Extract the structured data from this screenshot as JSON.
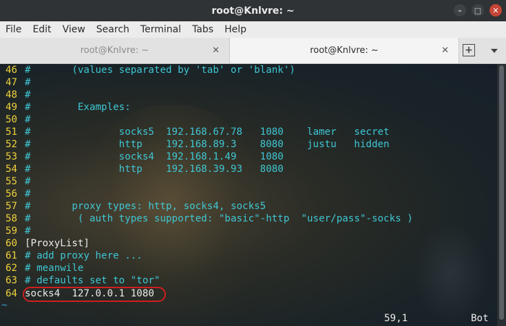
{
  "window": {
    "title": "root@Knlvre: ~",
    "btn_min": "–",
    "btn_max": "□",
    "btn_close": "✕"
  },
  "menu": [
    "File",
    "Edit",
    "View",
    "Search",
    "Terminal",
    "Tabs",
    "Help"
  ],
  "tabs": [
    {
      "label": "root@Knlvre: ~",
      "active": false
    },
    {
      "label": "root@Knlvre: ~",
      "active": true
    }
  ],
  "tab_close": "✕",
  "new_tab": "+",
  "lines": [
    {
      "n": "46",
      "t": "#       (values separated by 'tab' or 'blank')",
      "c": "comment"
    },
    {
      "n": "47",
      "t": "#",
      "c": "comment"
    },
    {
      "n": "48",
      "t": "#",
      "c": "comment"
    },
    {
      "n": "49",
      "t": "#        Examples:",
      "c": "comment"
    },
    {
      "n": "50",
      "t": "#",
      "c": "comment"
    },
    {
      "n": "51",
      "t": "#               socks5  192.168.67.78   1080    lamer   secret",
      "c": "comment"
    },
    {
      "n": "52",
      "t": "#               http    192.168.89.3    8080    justu   hidden",
      "c": "comment"
    },
    {
      "n": "53",
      "t": "#               socks4  192.168.1.49    1080",
      "c": "comment"
    },
    {
      "n": "54",
      "t": "#               http    192.168.39.93   8080",
      "c": "comment"
    },
    {
      "n": "55",
      "t": "#",
      "c": "comment"
    },
    {
      "n": "56",
      "t": "#",
      "c": "comment"
    },
    {
      "n": "57",
      "t": "#       proxy types: http, socks4, socks5",
      "c": "comment"
    },
    {
      "n": "58",
      "t": "#        ( auth types supported: \"basic\"-http  \"user/pass\"-socks )",
      "c": "comment"
    },
    {
      "n": "59",
      "t": "#",
      "c": "comment"
    },
    {
      "n": "60",
      "t": "[ProxyList]",
      "c": "text"
    },
    {
      "n": "61",
      "t": "# add proxy here ...",
      "c": "comment"
    },
    {
      "n": "62",
      "t": "# meanwile",
      "c": "comment"
    },
    {
      "n": "63",
      "t": "# defaults set to \"tor\"",
      "c": "comment"
    },
    {
      "n": "64",
      "t": "socks4  127.0.0.1 1080",
      "c": "text"
    }
  ],
  "tilde": "~",
  "status": {
    "position": "59,1",
    "scroll": "Bot"
  },
  "colors": {
    "line_number": "#f0d23c",
    "comment": "#3fc7d4",
    "text": "#ececec",
    "highlight": "#d11f1f"
  }
}
